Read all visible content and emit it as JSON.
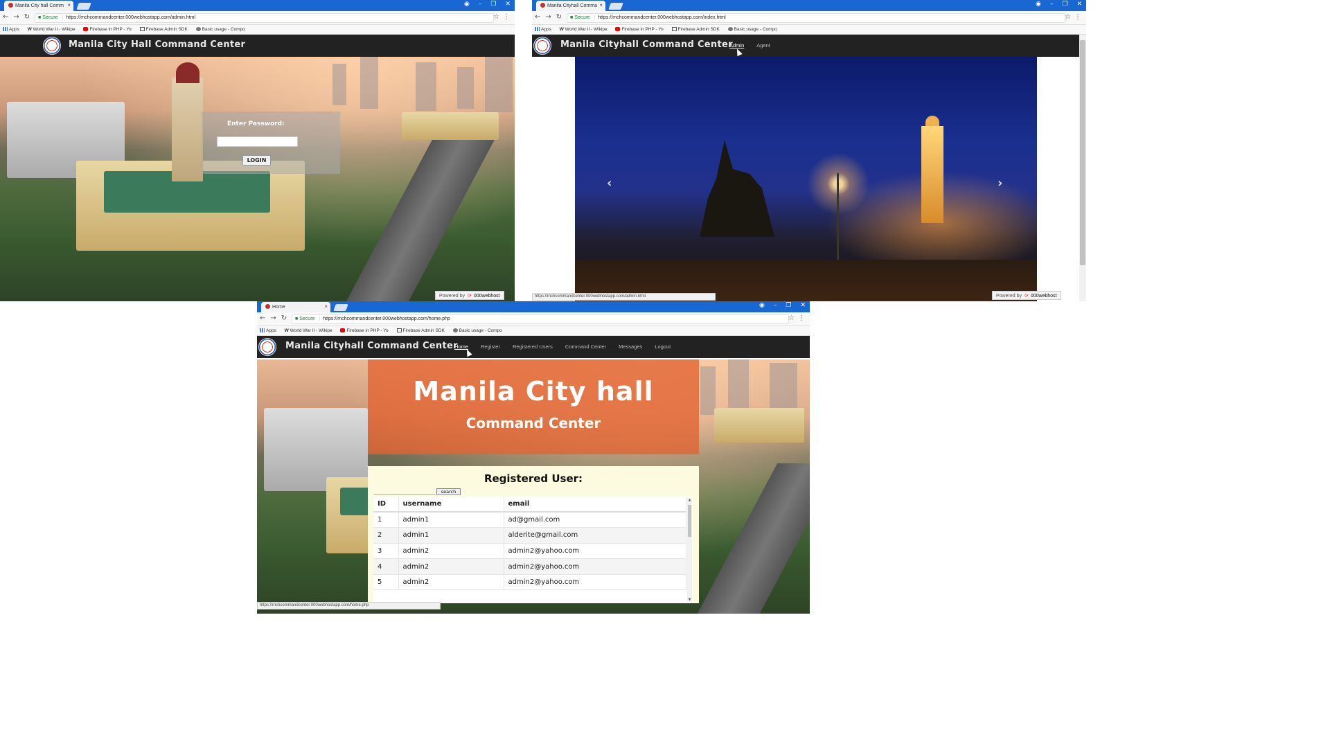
{
  "window1": {
    "tab_title": "Manila City hall Comm",
    "secure_label": "Secure",
    "url": "https://mchcommandcenter.000webhostapp.com/admin.html",
    "bookmarks": [
      "Apps",
      "World War II - Wikipe",
      "Firebase in PHP - Yo",
      "Firebase Admin SDK",
      "Basic usage - Compo"
    ],
    "brand": "Manila City Hall Command Center",
    "login_label": "Enter Password:",
    "login_button": "LOGIN",
    "powered_by": "Powered by",
    "host_brand": "000webhost"
  },
  "window2": {
    "tab_title": "Manila Cityhall Comma",
    "secure_label": "Secure",
    "url": "https://mchcommandcenter.000webhostapp.com/index.html",
    "bookmarks": [
      "Apps",
      "World War II - Wikipe",
      "Firebase in PHP - Yo",
      "Firebase Admin SDK",
      "Basic usage - Compo"
    ],
    "brand": "Manila Cityhall Command Center",
    "nav": [
      "Admin",
      "Agent"
    ],
    "carousel_prev": "‹",
    "carousel_next": "›",
    "status_url": "https://mchcommandcenter.000webhostapp.com/admin.html",
    "powered_by": "Powered by",
    "host_brand": "000webhost"
  },
  "window3": {
    "tab_title": "Home",
    "secure_label": "Secure",
    "url": "https://mchcommandcenter.000webhostapp.com/home.php",
    "bookmarks": [
      "Apps",
      "World War II - Wikipe",
      "Firebase in PHP - Yo",
      "Firebase Admin SDK",
      "Basic usage - Compo"
    ],
    "brand": "Manila Cityhall Command Center",
    "nav": [
      "Home",
      "Register",
      "Registered Users",
      "Command Center",
      "Messages",
      "Logout"
    ],
    "hero_title": "Manila City hall",
    "hero_subtitle": "Command Center",
    "panel_title": "Registered User:",
    "search_button": "search",
    "table": {
      "headers": [
        "ID",
        "username",
        "email"
      ],
      "rows": [
        [
          "1",
          "admin1",
          "ad@gmail.com"
        ],
        [
          "2",
          "admin1",
          "alderite@gmail.com"
        ],
        [
          "3",
          "admin2",
          "admin2@yahoo.com"
        ],
        [
          "4",
          "admin2",
          "admin2@yahoo.com"
        ],
        [
          "5",
          "admin2",
          "admin2@yahoo.com"
        ]
      ]
    },
    "status_url": "https://mchcommandcenter.000webhostapp.com/home.php"
  },
  "colors": {
    "chrome_titlebar": "#1967d2",
    "navbar": "#222222",
    "hero_overlay": "#e16432",
    "panel_bg": "#fcfbe0"
  }
}
